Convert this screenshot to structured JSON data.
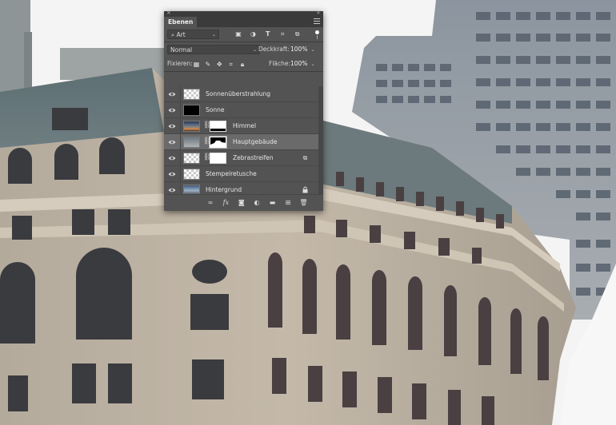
{
  "panel": {
    "tab_label": "Ebenen",
    "filter": {
      "label": "Art",
      "icons": [
        "image-filter-icon",
        "adjustment-filter-icon",
        "type-filter-icon",
        "shape-filter-icon",
        "smart-object-filter-icon"
      ]
    },
    "blend_mode": "Normal",
    "opacity_label": "Deckkraft:",
    "opacity_value": "100%",
    "lock_label": "Fixieren:",
    "fill_label": "Fläche:",
    "fill_value": "100%",
    "layers": [
      {
        "name": "Sonnenüberstrahlung",
        "thumb": "transparent",
        "has_mask": false,
        "visible": true,
        "selected": false,
        "badge": ""
      },
      {
        "name": "Sonne",
        "thumb": "black",
        "has_mask": false,
        "visible": true,
        "selected": false,
        "badge": ""
      },
      {
        "name": "Himmel",
        "thumb": "sky",
        "has_mask": true,
        "visible": true,
        "selected": false,
        "badge": ""
      },
      {
        "name": "Hauptgebäude",
        "thumb": "building",
        "has_mask": true,
        "visible": true,
        "selected": true,
        "badge": ""
      },
      {
        "name": "Zebrastreifen",
        "thumb": "transparent",
        "has_mask": true,
        "visible": true,
        "selected": false,
        "badge": "smart-object-icon"
      },
      {
        "name": "Stempelretusche",
        "thumb": "transparent",
        "has_mask": false,
        "visible": true,
        "selected": false,
        "badge": ""
      },
      {
        "name": "Hintergrund",
        "thumb": "street",
        "has_mask": false,
        "visible": true,
        "selected": false,
        "badge": "lock-icon"
      }
    ],
    "bottom_icons": [
      "link-layers-icon",
      "fx-icon",
      "add-mask-icon",
      "adjustment-layer-icon",
      "new-group-icon",
      "new-layer-icon",
      "trash-icon"
    ]
  },
  "colors": {
    "panel_bg": "#535353",
    "panel_dark": "#3b3b3b",
    "selected_row": "#6a6a6a"
  }
}
